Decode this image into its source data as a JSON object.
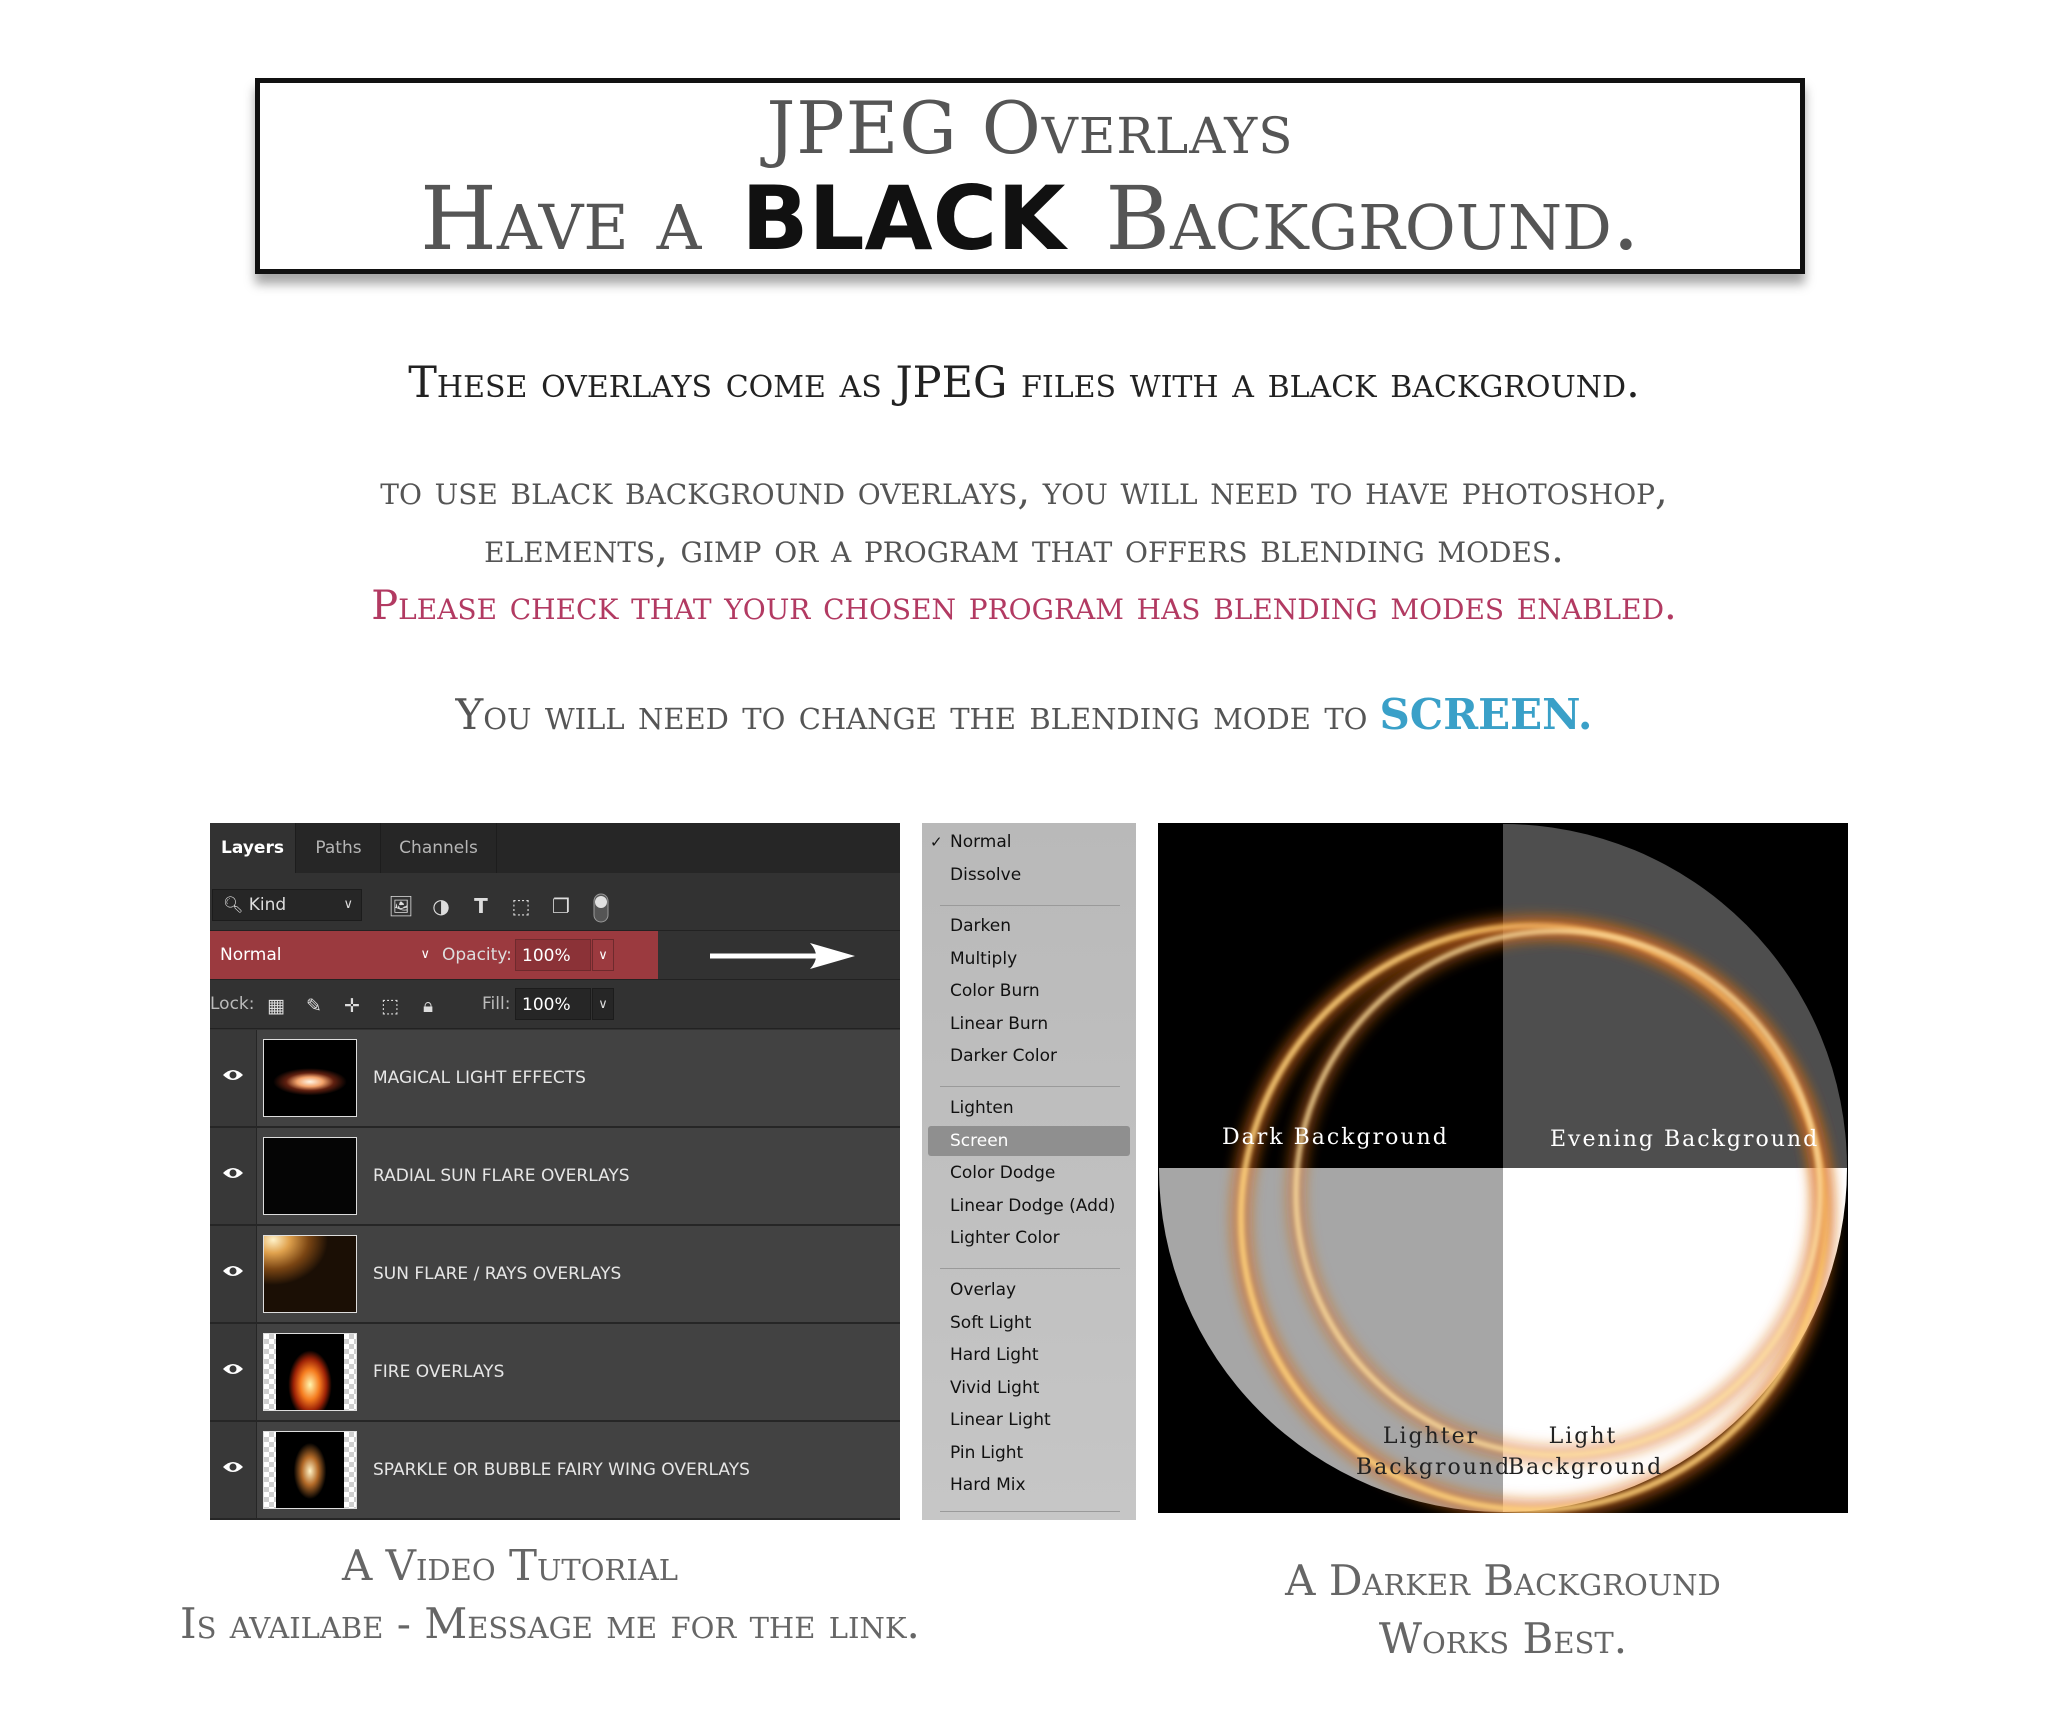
{
  "header": {
    "line1": "JPEG Overlays",
    "line2_pre": "Have a",
    "line2_bold": "BLACK",
    "line2_post": "Background."
  },
  "text": {
    "intro": "These overlays come as JPEG files with a black background.",
    "requirement_line1": "to use black background overlays, you will need to  have photoshop,",
    "requirement_line2": "elements, gimp or a program that offers blending modes.",
    "requirement_line3": "Please check that your chosen program has blending modes enabled.",
    "need_prefix": "You will need to change the blending mode to",
    "need_mode": "SCREEN."
  },
  "colors": {
    "accent_pink": "#b23a62",
    "accent_blue": "#3aa0c8",
    "panel_bg": "#323232",
    "blend_highlight": "#9b3a3f"
  },
  "layers_panel": {
    "tabs": [
      "Layers",
      "Paths",
      "Channels"
    ],
    "active_tab": "Layers",
    "filter_kind": "Kind",
    "filter_icons": [
      "image-filter-icon",
      "adjustment-filter-icon",
      "type-filter-icon",
      "shape-filter-icon",
      "smart-object-filter-icon",
      "filter-toggle-icon"
    ],
    "blend_mode": "Normal",
    "opacity_label": "Opacity:",
    "opacity_value": "100%",
    "lock_label": "Lock:",
    "lock_icons": [
      "lock-transparent-pixels-icon",
      "lock-image-pixels-icon",
      "lock-position-icon",
      "lock-artboard-icon",
      "lock-all-icon"
    ],
    "fill_label": "Fill:",
    "fill_value": "100%",
    "layers": [
      {
        "name": "MAGICAL LIGHT EFFECTS"
      },
      {
        "name": "RADIAL SUN FLARE OVERLAYS"
      },
      {
        "name": "SUN FLARE / RAYS OVERLAYS"
      },
      {
        "name": "FIRE OVERLAYS"
      },
      {
        "name": "SPARKLE OR BUBBLE FAIRY WING OVERLAYS"
      }
    ]
  },
  "blend_menu": {
    "groups": [
      [
        "Normal",
        "Dissolve"
      ],
      [
        "Darken",
        "Multiply",
        "Color Burn",
        "Linear Burn",
        "Darker Color"
      ],
      [
        "Lighten",
        "Screen",
        "Color Dodge",
        "Linear Dodge (Add)",
        "Lighter Color"
      ],
      [
        "Overlay",
        "Soft Light",
        "Hard Light",
        "Vivid Light",
        "Linear Light",
        "Pin Light",
        "Hard Mix"
      ]
    ],
    "checked": "Normal",
    "highlighted": "Screen"
  },
  "demo": {
    "label_dark": "Dark Background",
    "label_evening": "Evening Background",
    "label_lighter_1": "Lighter",
    "label_lighter_2": "Background",
    "label_light_1": "Light",
    "label_light_2": "Background"
  },
  "captions": {
    "left_line1": "A Video Tutorial",
    "left_line2": "Is availabe - Message me for the link.",
    "right_line1": "A Darker Background",
    "right_line2": "Works Best."
  }
}
